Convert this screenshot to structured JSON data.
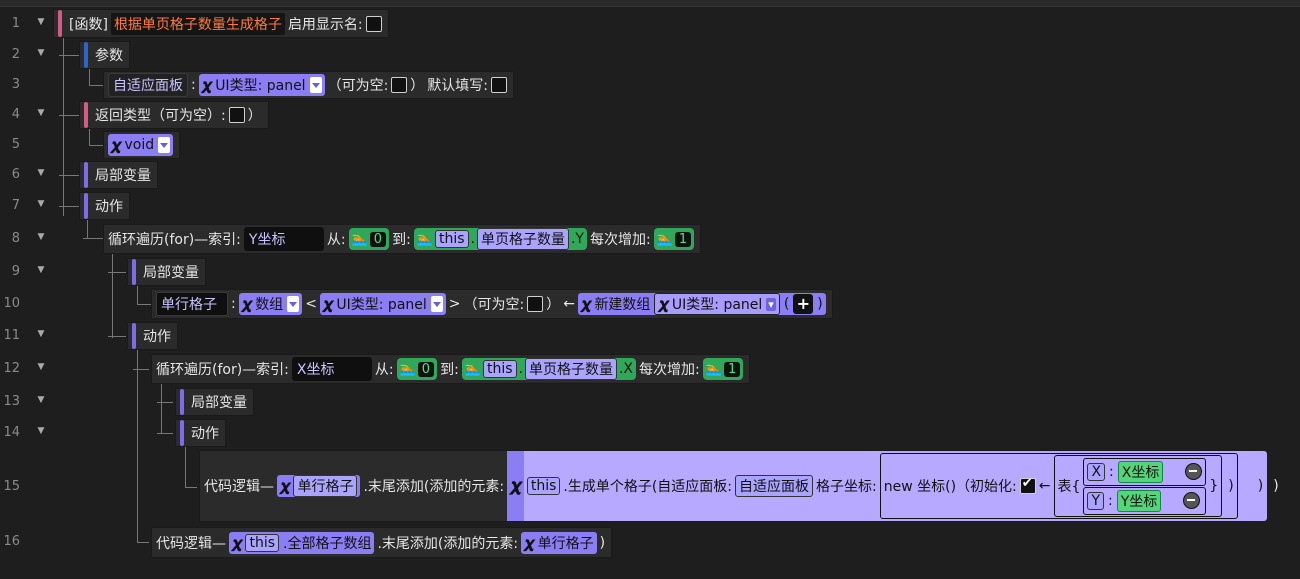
{
  "lines": [
    "1",
    "2",
    "3",
    "4",
    "5",
    "6",
    "7",
    "8",
    "9",
    "10",
    "11",
    "12",
    "13",
    "14",
    "15",
    "16"
  ],
  "func": {
    "bracket": "[函数]",
    "name": "根据单页格子数量生成格子",
    "show_name_label": "启用显示名:"
  },
  "params": {
    "label": "参数",
    "name": "自适应面板",
    "colon": ":",
    "type_label": "UI类型: panel",
    "nullable": "（可为空:",
    "nullable_end": "）",
    "default_label": "默认填写:"
  },
  "ret": {
    "label": "返回类型（可为空）:",
    "close": "）",
    "type": "void"
  },
  "local_vars": "局部变量",
  "actions": "动作",
  "for1": {
    "label": "循环遍历(for)—索引:",
    "index": "Y坐标",
    "from": "从:",
    "from_val": "0",
    "to": "到:",
    "this": "this",
    "dot": ".",
    "member": "单页格子数量",
    "suffix": ".Y",
    "step": "每次增加:",
    "step_val": "1"
  },
  "local_vars2": "局部变量",
  "var_line": {
    "name": "单行格子",
    "colon": ":",
    "type": "数组",
    "lt": "<",
    "inner_type": "UI类型: panel",
    "gt": ">",
    "nullable": "（可为空:",
    "nullable_end": "）",
    "arrow": "←",
    "new_array": "新建数组",
    "new_type": "UI类型: panel",
    "paren": "(",
    "plus": "+",
    "close": ")"
  },
  "actions2": "动作",
  "for2": {
    "label": "循环遍历(for)—索引:",
    "index": "X坐标",
    "from": "从:",
    "from_val": "0",
    "to": "到:",
    "this": "this",
    "dot": ".",
    "member": "单页格子数量",
    "suffix": ".X",
    "step": "每次增加:",
    "step_val": "1"
  },
  "local_vars3": "局部变量",
  "actions3": "动作",
  "line15": {
    "prefix": "代码逻辑—",
    "target": "单行格子",
    "method": ".末尾添加(添加的元素:",
    "this": "this",
    "call": ".生成单个格子(自适应面板:",
    "arg": "自适应面板",
    "coord_label": "格子坐标:",
    "new_label": "new 坐标()（初始化:",
    "arrow": "←",
    "table": "表{",
    "x_key": "X",
    "x_val": "X坐标",
    "y_key": "Y",
    "y_val": "Y坐标",
    "colon": ":",
    "close_brace": "}",
    "close1": ")",
    "close2": ")",
    "close3": ")"
  },
  "line16": {
    "prefix": "代码逻辑—",
    "this": "this",
    "member": ".全部格子数组",
    "method": ".末尾添加(添加的元素:",
    "arg": "单行格子",
    "close": ")"
  }
}
